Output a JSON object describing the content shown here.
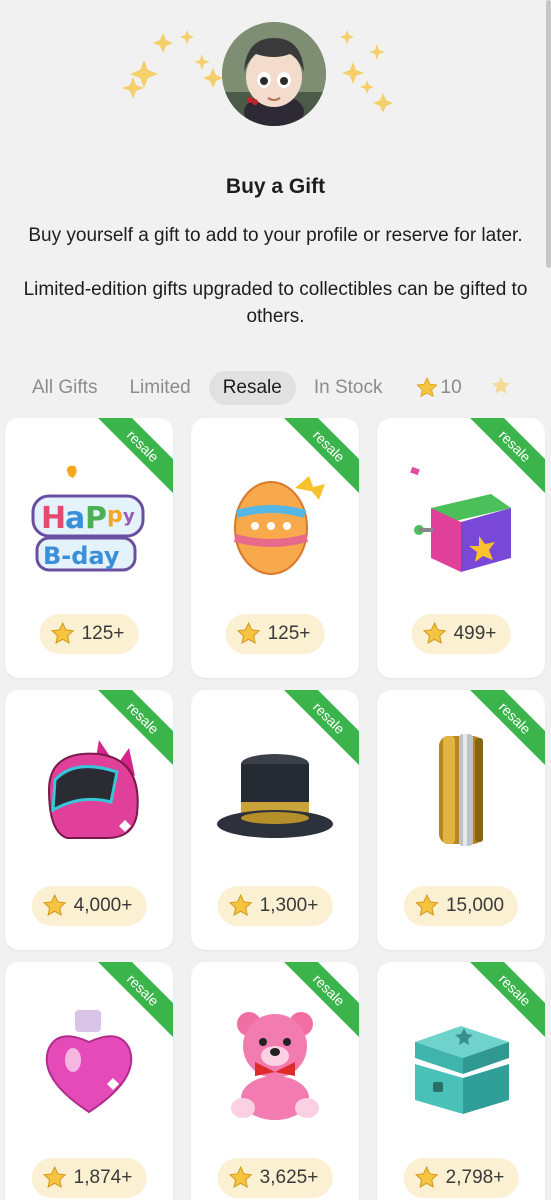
{
  "header": {
    "title": "Buy a Gift",
    "description": "Buy yourself a gift to add to your profile or reserve for later.",
    "description2": "Limited-edition gifts upgraded to collectibles can be gifted to others."
  },
  "tabs": [
    {
      "label": "All Gifts",
      "active": false
    },
    {
      "label": "Limited",
      "active": false
    },
    {
      "label": "Resale",
      "active": true
    },
    {
      "label": "In Stock",
      "active": false
    }
  ],
  "star_tab": {
    "label": "10",
    "icon": "star-icon"
  },
  "colors": {
    "ribbon": "#3cb44c",
    "price_pill": "#fbf0d2",
    "star": "#f5c542",
    "background": "#f1f1f1"
  },
  "gifts": [
    {
      "name": "happy-bday",
      "ribbon": "resale",
      "price": "125+"
    },
    {
      "name": "easter-egg",
      "ribbon": "resale",
      "price": "125+"
    },
    {
      "name": "jack-in-the-box",
      "ribbon": "resale",
      "price": "499+"
    },
    {
      "name": "cat-helmet",
      "ribbon": "resale",
      "price": "4,000+"
    },
    {
      "name": "top-hat",
      "ribbon": "resale",
      "price": "1,300+"
    },
    {
      "name": "ring",
      "ribbon": "resale",
      "price": "15,000"
    },
    {
      "name": "love-potion",
      "ribbon": "resale",
      "price": "1,874+"
    },
    {
      "name": "teddy-bear",
      "ribbon": "resale",
      "price": "3,625+"
    },
    {
      "name": "jewelry-box",
      "ribbon": "resale",
      "price": "2,798+"
    }
  ]
}
